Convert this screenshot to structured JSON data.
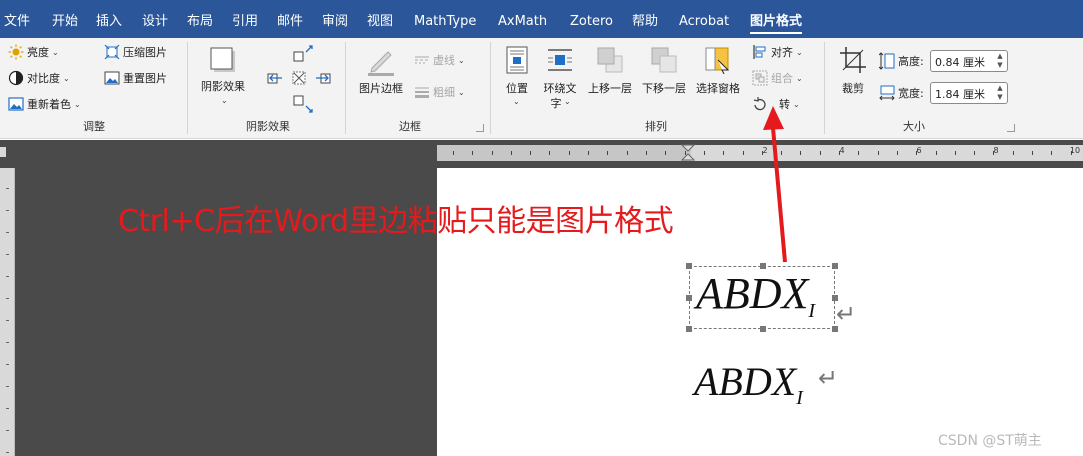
{
  "menu": {
    "tabs": [
      "文件",
      "开始",
      "插入",
      "设计",
      "布局",
      "引用",
      "邮件",
      "审阅",
      "视图",
      "MathType",
      "AxMath",
      "Zotero",
      "帮助",
      "Acrobat",
      "图片格式"
    ],
    "active": "图片格式"
  },
  "ribbon": {
    "adjust": {
      "brightness": "亮度",
      "contrast": "对比度",
      "recolor": "重新着色",
      "compress": "压缩图片",
      "reset": "重置图片",
      "group_label": "调整"
    },
    "shadow": {
      "shadow_effect": "阴影效果",
      "group_label": "阴影效果"
    },
    "border": {
      "picture_border": "图片边框",
      "dashes": "虚线",
      "weight": "粗细",
      "group_label": "边框"
    },
    "arrange": {
      "position": "位置",
      "wrap_text_1": "环绕文",
      "wrap_text_2": "字",
      "bring_forward": "上移一层",
      "send_backward": "下移一层",
      "selection_pane": "选择窗格",
      "align": "对齐",
      "group": "组合",
      "rotate": "转",
      "group_label": "排列"
    },
    "size": {
      "crop": "裁剪",
      "height_label": "高度:",
      "height_value": "0.84 厘米",
      "width_label": "宽度:",
      "width_value": "1.84 厘米",
      "group_label": "大小"
    }
  },
  "ruler": {
    "numbers": [
      "2",
      "4",
      "6",
      "8",
      "10"
    ]
  },
  "document": {
    "annotation": "Ctrl+C后在Word里边粘贴只能是图片格式",
    "formula_main": "ABDX",
    "formula_sub": "I",
    "return_mark": "↵",
    "arrow_color": "#e41a1c"
  },
  "watermark": "CSDN @ST萌主"
}
